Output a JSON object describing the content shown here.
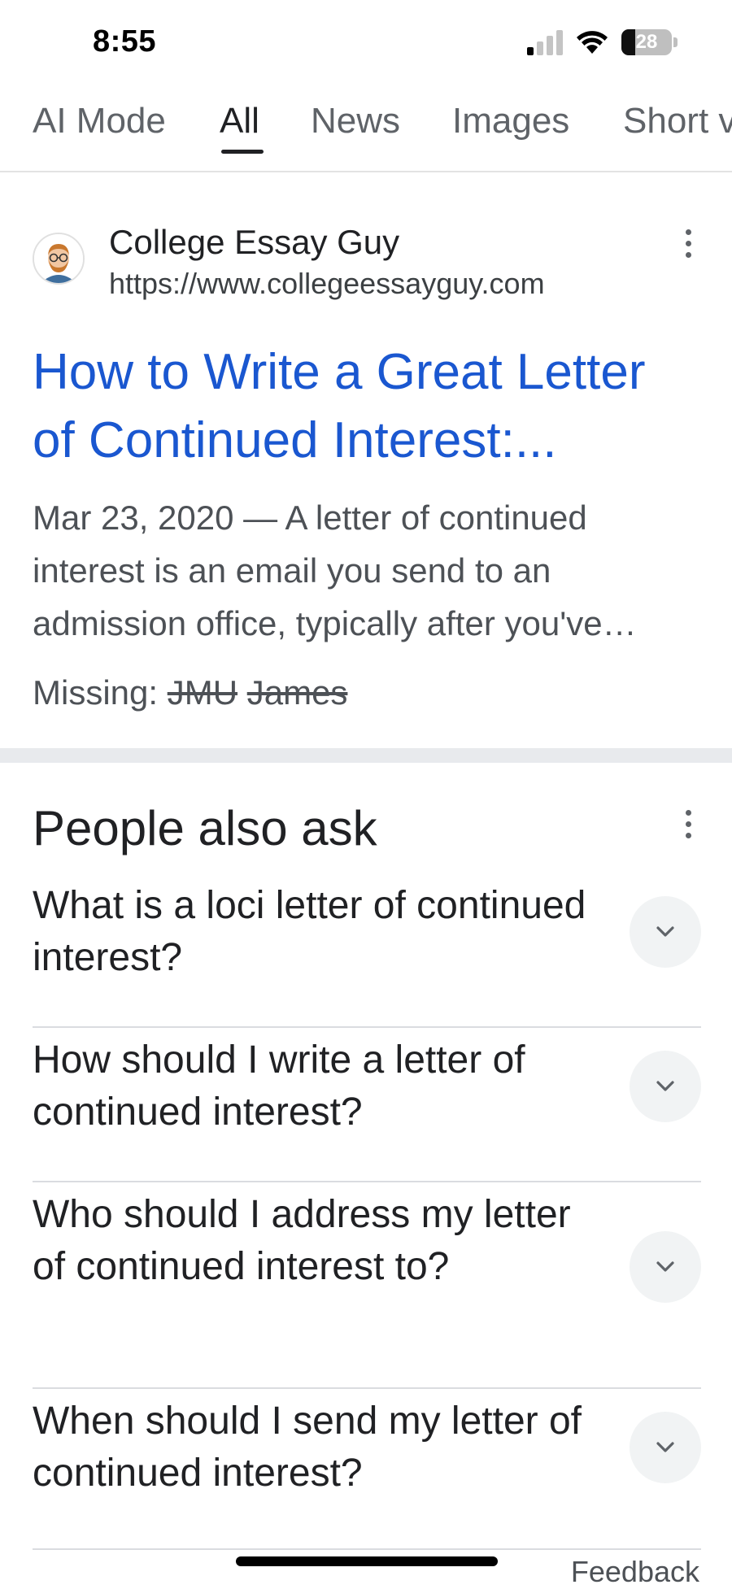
{
  "status_bar": {
    "time": "8:55",
    "battery_level": "28",
    "battery_fraction": 0.28
  },
  "tabs": [
    {
      "label": "AI Mode",
      "active": false
    },
    {
      "label": "All",
      "active": true
    },
    {
      "label": "News",
      "active": false
    },
    {
      "label": "Images",
      "active": false
    },
    {
      "label": "Short videos",
      "active": false
    }
  ],
  "result": {
    "site_name": "College Essay Guy",
    "url": "https://www.collegeessayguy.com",
    "title_line1": "How to Write a Great Letter",
    "title_line2": "of Continued Interest:...",
    "snippet_line1": "Mar 23, 2020 — A letter of continued",
    "snippet_line2": "interest is an email you send to an",
    "snippet_line3": "admission office, typically after you've…",
    "missing_label": "Missing:",
    "missing_terms": [
      "JMU",
      "James"
    ],
    "favicon_icon": "avatar-icon"
  },
  "people_also_ask": {
    "title": "People also ask",
    "questions": [
      "What is a loci letter of continued interest?",
      "How should I write a letter of continued interest?",
      "Who should I address my letter of continued interest to?",
      "When should I send my letter of continued interest?"
    ]
  },
  "footer": {
    "feedback_label": "Feedback"
  },
  "colors": {
    "link_blue": "#1a57d0",
    "text_primary": "#202124",
    "text_secondary": "#4d5156",
    "divider_band": "#e8eaed",
    "chevron_bg": "#f1f3f4"
  }
}
